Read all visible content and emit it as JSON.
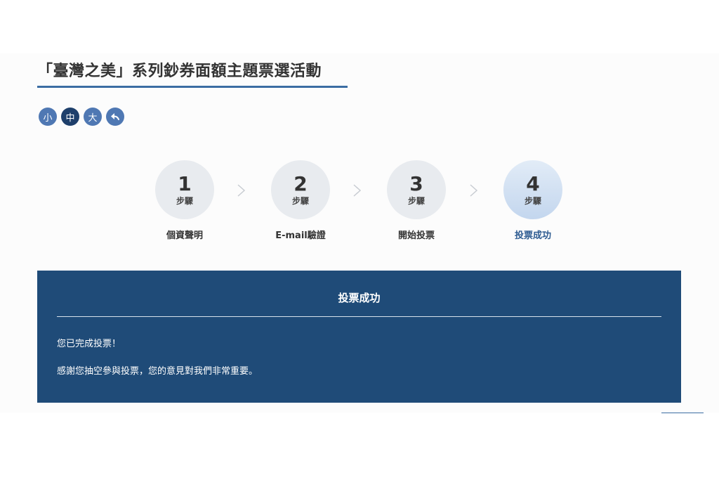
{
  "header": {
    "title": "「臺灣之美」系列鈔券面額主題票選活動"
  },
  "font_size_controls": {
    "small": "小",
    "medium": "中",
    "large": "大",
    "back_icon": "back-arrow-icon"
  },
  "steps": [
    {
      "number": "1",
      "unit": "步驟",
      "label": "個資聲明"
    },
    {
      "number": "2",
      "unit": "步驟",
      "label": "E-mail驗證"
    },
    {
      "number": "3",
      "unit": "步驟",
      "label": "開始投票"
    },
    {
      "number": "4",
      "unit": "步驟",
      "label": "投票成功"
    }
  ],
  "current_step": 4,
  "result": {
    "title": "投票成功",
    "line1": "您已完成投票！",
    "line2": "感謝您抽空參與投票，您的意見對我們非常重要。"
  },
  "colors": {
    "accent": "#3b6da3",
    "panel": "#1f4b78",
    "current_step_text": "#2d5b91"
  }
}
